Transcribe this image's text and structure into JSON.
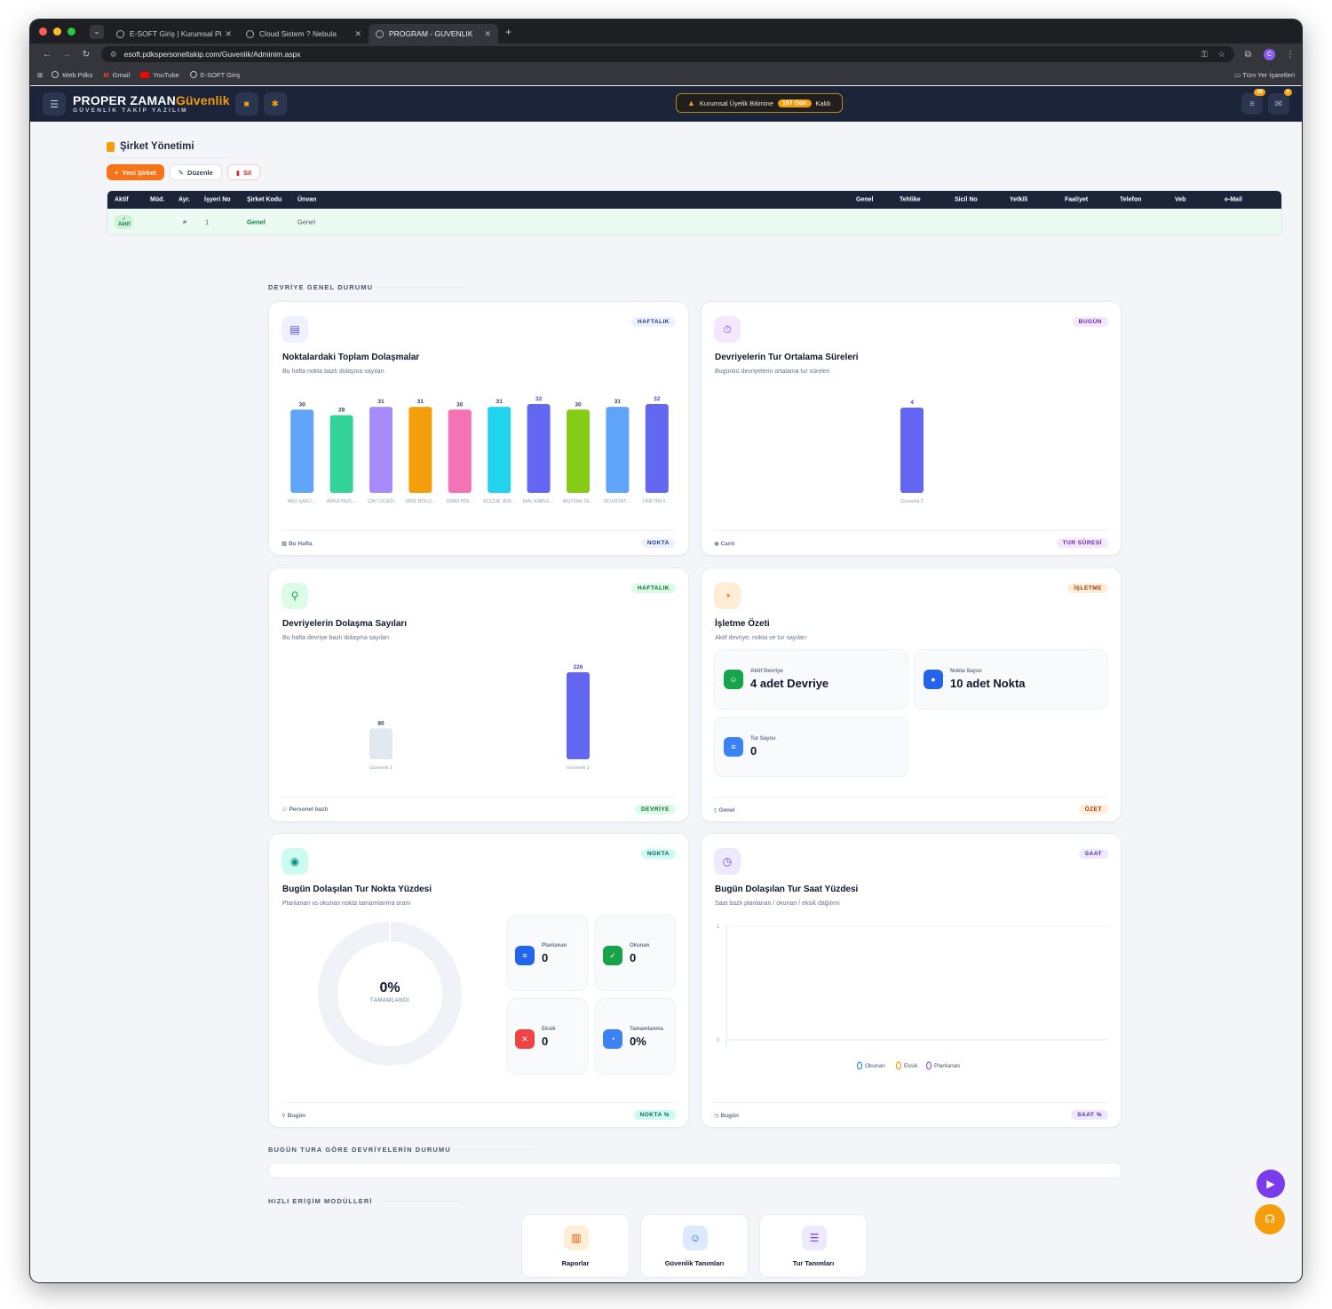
{
  "browser": {
    "tabs": [
      {
        "title": "E-SOFT Giriş | Kurumsal Platf..."
      },
      {
        "title": "Cloud Sistem ? Nebula"
      },
      {
        "title": "PROGRAM - GUVENLIK"
      }
    ],
    "url": "esoft.pdkspersoneltakip.com/Guvenlik/Adminim.aspx",
    "bookmarks": [
      "Web Pdks",
      "Gmail",
      "YouTube",
      "E-SOFT Giriş"
    ],
    "bookmarks_right": "Tüm Yer İşaretleri",
    "profile_initial": "C"
  },
  "header": {
    "brand_main": "PROPER ZAMAN",
    "brand_accent": "Güvenlik",
    "brand_sub": "GÜVENLİK TAKİP YAZILIM",
    "alert_text": "Kurumsal Üyelik Bitimine",
    "alert_days": "167 Gün",
    "alert_suffix": "Kaldı",
    "badge_1": "30",
    "badge_2": "0",
    "accent_color": "#f59e0b",
    "navy": "#1b2438"
  },
  "company": {
    "title": "Şirket Yönetimi",
    "buttons": {
      "new": "Yeni Şirket",
      "edit": "Düzenle",
      "delete": "Sil"
    },
    "columns": [
      "Aktif",
      "Müd.",
      "Ayr.",
      "İşyeri No",
      "Şirket Kodu",
      "Ünvan",
      "Genel",
      "Tehlike",
      "Sicil No",
      "Yetkili",
      "Faaliyet",
      "Telefon",
      "Veb",
      "e-Mail"
    ],
    "row": {
      "active": "Aktif",
      "ayr": "#",
      "isyeri_no": "1",
      "sirket_kodu": "Genel",
      "unvan": "Genel"
    }
  },
  "sections": {
    "patrol": "DEVRİYE GENEL DURUMU",
    "today": "BUGÜN TURA GÖRE DEVRİYELERİN DURUMU",
    "quick": "HIZLI ERİŞİM MODÜLLERİ"
  },
  "cards": {
    "c1": {
      "title": "Noktalardaki Toplam Dolaşmalar",
      "subtitle": "Bu hafta nokta bazlı dolaşma sayıları",
      "pill": "HAFTALIK",
      "foot_left": "Bu Hafta",
      "foot_right": "NOKTA"
    },
    "c2": {
      "title": "Devriyelerin Tur Ortalama Süreleri",
      "subtitle": "Bugünkü devriyelerin ortalama tur süreleri",
      "pill": "BUGÜN",
      "foot_left": "Canlı",
      "foot_right": "TUR SÜRESİ"
    },
    "c3": {
      "title": "Devriyelerin Dolaşma Sayıları",
      "subtitle": "Bu hafta devriye bazlı dolaşma sayıları",
      "pill": "HAFTALIK",
      "foot_left": "Personel bazlı",
      "foot_right": "DEVRİYE"
    },
    "c4": {
      "title": "İşletme Özeti",
      "subtitle": "Aktif devriye, nokta ve tur sayıları",
      "pill": "İŞLETME",
      "foot_left": "Genel",
      "foot_right": "ÖZET",
      "stats": [
        {
          "label": "Aktif Devriye",
          "value": "4 adet Devriye"
        },
        {
          "label": "Nokta Sayısı",
          "value": "10 adet Nokta"
        },
        {
          "label": "Tur Sayısı",
          "value": "0"
        }
      ]
    },
    "c5": {
      "title": "Bugün Dolaşılan Tur Nokta Yüzdesi",
      "subtitle": "Planlanan vs okunan nokta tamamlanma oranı",
      "pill": "NOKTA",
      "foot_left": "Bugün",
      "foot_right": "NOKTA %",
      "donut_value": "0%",
      "donut_label": "TAMAMLANDI",
      "stats": [
        {
          "label": "Planlanan",
          "value": "0"
        },
        {
          "label": "Okunan",
          "value": "0"
        },
        {
          "label": "Eksik",
          "value": "0"
        },
        {
          "label": "Tamamlanma",
          "value": "0%"
        }
      ]
    },
    "c6": {
      "title": "Bugün Dolaşılan Tur Saat Yüzdesi",
      "subtitle": "Saat bazlı planlanan / okunan / eksik dağılımı",
      "pill": "SAAT",
      "foot_left": "Bugün",
      "foot_right": "SAAT %"
    }
  },
  "chart_data": [
    {
      "type": "bar",
      "categories": [
        "AKÜ ŞARJ ...",
        "ARKA YAZL...",
        "ÇAY OCAĞI",
        "İADE BÖLÜ...",
        "İDARİ BİN...",
        "KÜÇÜK JEN...",
        "MAL KABUL...",
        "MUTFAK Gİ...",
        "SEVKİYAT ...",
        "ÜRETİM 5 ..."
      ],
      "values": [
        30,
        28,
        31,
        31,
        30,
        31,
        32,
        30,
        31,
        32
      ],
      "colors": [
        "#60a5fa",
        "#34d399",
        "#a78bfa",
        "#f59e0b",
        "#f472b6",
        "#22d3ee",
        "#6366f1",
        "#84cc16",
        "#60a5fa",
        "#6366f1"
      ],
      "ylim": [
        0,
        32
      ]
    },
    {
      "type": "bar",
      "categories": [
        "Güvenlik 2"
      ],
      "values": [
        4
      ],
      "colors": [
        "#6366f1"
      ],
      "ylim": [
        0,
        4
      ]
    },
    {
      "type": "bar",
      "categories": [
        "Güvenlik 1",
        "Güvenlik 2"
      ],
      "values": [
        80,
        226
      ],
      "colors": [
        "#e2e8f0",
        "#6366f1"
      ],
      "ylim": [
        0,
        226
      ]
    },
    {
      "type": "line",
      "categories": [],
      "series": [
        {
          "name": "Okunan",
          "values": []
        },
        {
          "name": "Eksik",
          "values": []
        },
        {
          "name": "Planlanan",
          "values": []
        }
      ],
      "ylim": [
        0,
        1
      ],
      "y_ticks": [
        "1",
        "0"
      ],
      "legend": "bottom",
      "series_colors": [
        "#3b82f6",
        "#f59e0b",
        "#8b5cf6"
      ]
    }
  ],
  "quick_modules": [
    "Raporlar",
    "Güvenlik Tanımları",
    "Tur Tanımları"
  ]
}
